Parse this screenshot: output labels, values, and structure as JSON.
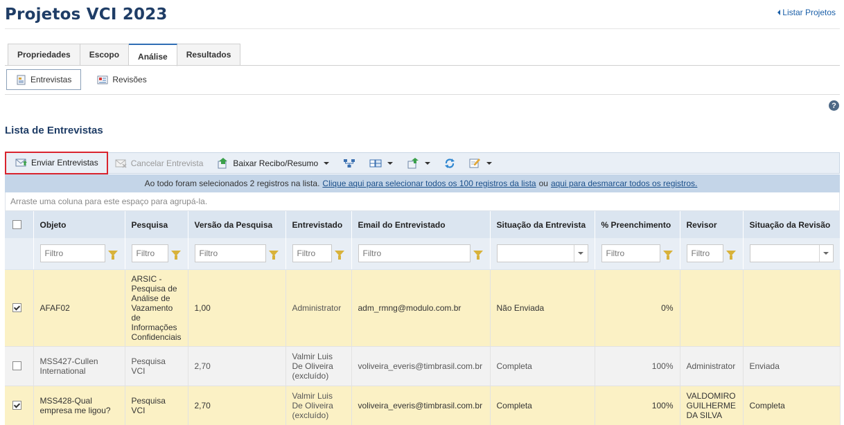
{
  "header": {
    "title": "Projetos VCI 2023",
    "back_link": "Listar Projetos"
  },
  "tabs": [
    {
      "label": "Propriedades"
    },
    {
      "label": "Escopo"
    },
    {
      "label": "Análise"
    },
    {
      "label": "Resultados"
    }
  ],
  "subtabs": [
    {
      "label": "Entrevistas",
      "icon": "interviews-icon"
    },
    {
      "label": "Revisões",
      "icon": "reviews-icon"
    }
  ],
  "section_title": "Lista de Entrevistas",
  "toolbar": {
    "send": "Enviar Entrevistas",
    "cancel": "Cancelar Entrevista",
    "download": "Baixar Recibo/Resumo"
  },
  "selection_bar": {
    "text": "Ao todo foram selecionados 2 registros na lista.",
    "select_all_link": "Clique aqui para selecionar todos os 100 registros da lista",
    "or": "ou",
    "deselect_link": "aqui para desmarcar todos os registros."
  },
  "group_area": "Arraste uma coluna para este espaço para agrupá-la.",
  "grid": {
    "filter_placeholder": "Filtro",
    "columns": [
      "Objeto",
      "Pesquisa",
      "Versão da Pesquisa",
      "Entrevistado",
      "Email do Entrevistado",
      "Situação da Entrevista",
      "% Preenchimento",
      "Revisor",
      "Situação da Revisão"
    ],
    "rows": [
      {
        "checked": true,
        "objeto": "AFAF02",
        "pesquisa": "ARSIC - Pesquisa de Análise de Vazamento de Informações Confidenciais",
        "versao": "1,00",
        "entrevistado": "Administrator",
        "email": "adm_rmng@modulo.com.br",
        "situacao": "Não Enviada",
        "preenchimento": "0%",
        "revisor": "",
        "situacao_revisao": ""
      },
      {
        "checked": false,
        "objeto": "MSS427-Cullen International",
        "pesquisa": "Pesquisa VCI",
        "versao": "2,70",
        "entrevistado": "Valmir Luis De Oliveira (excluído)",
        "email": "voliveira_everis@timbrasil.com.br",
        "situacao": "Completa",
        "preenchimento": "100%",
        "revisor": "Administrator",
        "situacao_revisao": "Enviada"
      },
      {
        "checked": true,
        "objeto": "MSS428-Qual empresa me ligou?",
        "pesquisa": "Pesquisa VCI",
        "versao": "2,70",
        "entrevistado": "Valmir Luis De Oliveira (excluído)",
        "email": "voliveira_everis@timbrasil.com.br",
        "situacao": "Completa",
        "preenchimento": "100%",
        "revisor": "VALDOMIRO GUILHERME DA SILVA",
        "situacao_revisao": "Completa"
      }
    ]
  }
}
